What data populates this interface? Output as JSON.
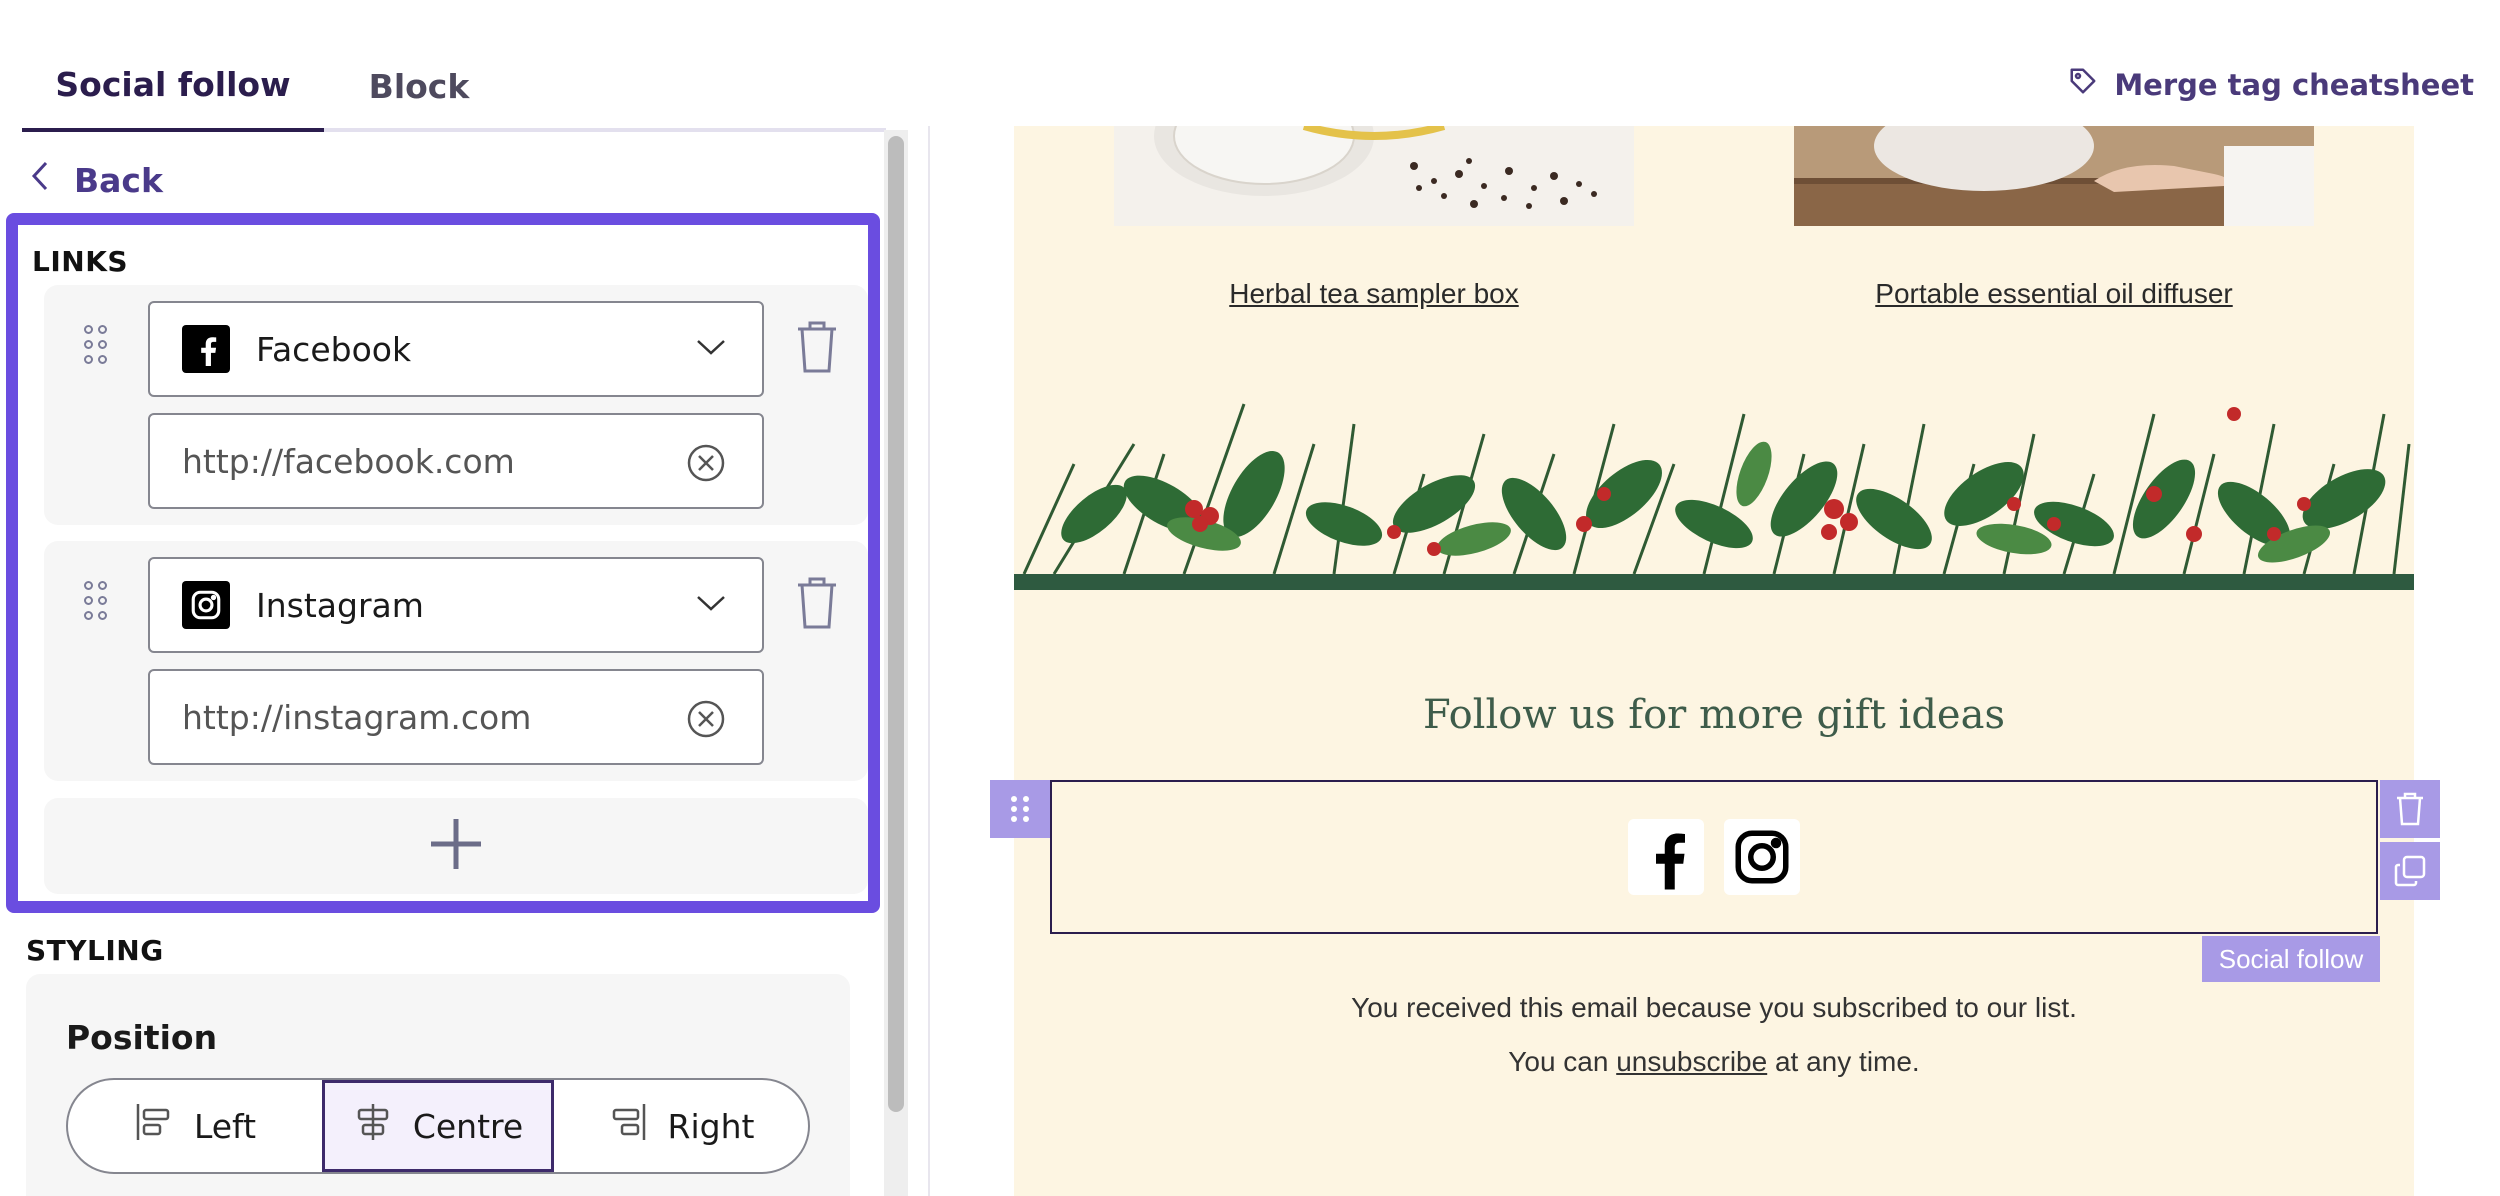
{
  "tabs": [
    {
      "label": "Social follow",
      "active": true
    },
    {
      "label": "Block",
      "active": false
    }
  ],
  "merge_tag": {
    "label": "Merge tag cheatsheet",
    "icon": "tag-icon"
  },
  "back": {
    "label": "Back",
    "icon": "chevron-left-icon"
  },
  "links": {
    "section_label": "LINKS",
    "items": [
      {
        "network": "Facebook",
        "icon": "facebook-icon",
        "url": "http://facebook.com"
      },
      {
        "network": "Instagram",
        "icon": "instagram-icon",
        "url": "http://instagram.com"
      }
    ],
    "add_icon": "plus-icon"
  },
  "styling": {
    "section_label": "STYLING",
    "position": {
      "title": "Position",
      "options": [
        "Left",
        "Centre",
        "Right"
      ],
      "selected": "Centre"
    }
  },
  "preview": {
    "products": [
      {
        "caption": "Herbal tea sampler box"
      },
      {
        "caption": "Portable essential oil diffuser"
      }
    ],
    "follow_heading": "Follow us for more gift ideas",
    "footer_line_1": "You received this email because you subscribed to our list.",
    "footer_line_2_before": "You can ",
    "footer_line_2_link": "unsubscribe",
    "footer_line_2_after": " at any time.",
    "block_tag": "Social follow"
  },
  "colors": {
    "accent": "#6a4de0",
    "tab_active": "#2b1d4d",
    "block_toolbar": "#a89ae6",
    "email_background": "#fdf5e2",
    "heading_green": "#3e5c4a"
  }
}
